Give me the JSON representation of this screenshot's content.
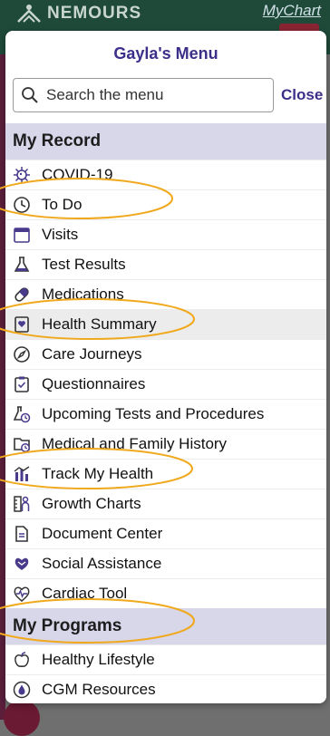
{
  "app": {
    "brand": "NEMOURS",
    "portal": "MyChart"
  },
  "menu": {
    "title": "Gayla's Menu",
    "search_placeholder": "Search the menu",
    "close_label": "Close",
    "sections": [
      {
        "heading": "My Record",
        "items": [
          {
            "label": "COVID-19",
            "icon": "virus-icon"
          },
          {
            "label": "To Do",
            "icon": "clock-icon"
          },
          {
            "label": "Visits",
            "icon": "calendar-icon"
          },
          {
            "label": "Test Results",
            "icon": "flask-icon"
          },
          {
            "label": "Medications",
            "icon": "pill-icon"
          },
          {
            "label": "Health Summary",
            "icon": "heart-document-icon"
          },
          {
            "label": "Care Journeys",
            "icon": "compass-icon"
          },
          {
            "label": "Questionnaires",
            "icon": "checklist-icon"
          },
          {
            "label": "Upcoming Tests and Procedures",
            "icon": "flask-clock-icon"
          },
          {
            "label": "Medical and Family History",
            "icon": "folder-clock-icon"
          },
          {
            "label": "Track My Health",
            "icon": "bar-chart-icon"
          },
          {
            "label": "Growth Charts",
            "icon": "growth-chart-icon"
          },
          {
            "label": "Document Center",
            "icon": "document-icon"
          },
          {
            "label": "Social Assistance",
            "icon": "social-icon"
          },
          {
            "label": "Cardiac Tool",
            "icon": "heart-pulse-icon"
          }
        ]
      },
      {
        "heading": "My Programs",
        "items": [
          {
            "label": "Healthy Lifestyle",
            "icon": "apple-icon"
          },
          {
            "label": "CGM Resources",
            "icon": "drop-icon"
          }
        ]
      }
    ]
  },
  "colors": {
    "accent": "#3b2f8a",
    "section_bg": "#d8d6e9",
    "annotation": "#f0a91c",
    "icon": "#4a3a8c"
  }
}
